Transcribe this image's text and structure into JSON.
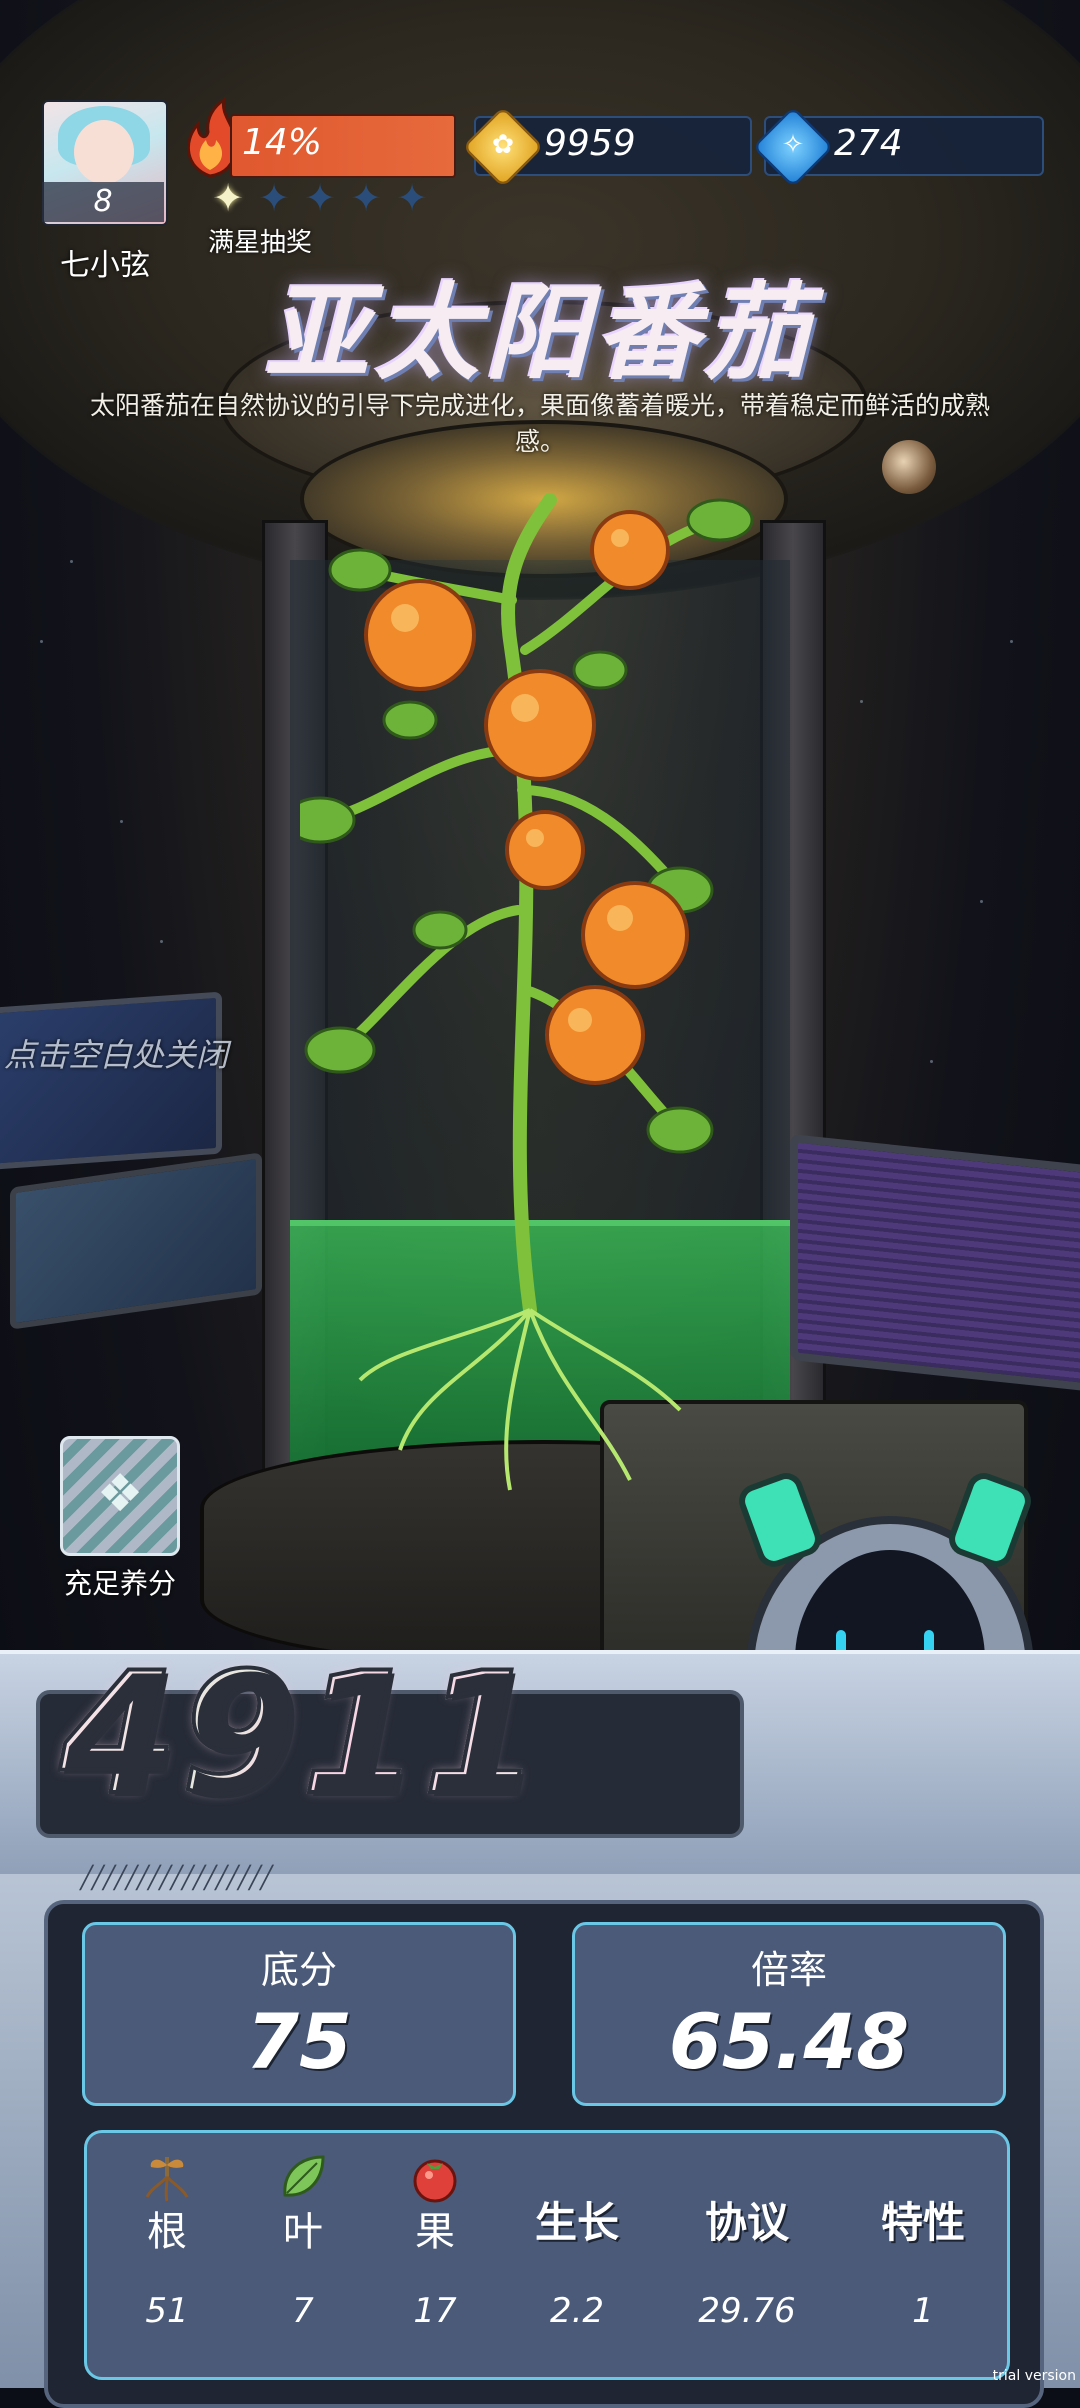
{
  "player": {
    "name": "七小弦",
    "level": "8",
    "progress_text": "14%",
    "progress_fraction": 0.14,
    "stars_total": 5,
    "stars_lit": 1,
    "lottery_label": "满星抽奖"
  },
  "resources": {
    "coins": {
      "value": "9959",
      "icon": "gold-coin-icon"
    },
    "gems": {
      "value": "274",
      "icon": "blue-gem-icon"
    }
  },
  "plant": {
    "title": "亚太阳番茄",
    "description": "太阳番茄在自然协议的引导下完成进化，果面像蓄着暖光，带着稳定而鲜活的成熟感。"
  },
  "hints": {
    "close": "点击空白处关闭",
    "nutrient_label": "充足养分"
  },
  "score": {
    "total": "4911",
    "base_label": "底分",
    "base_value": "75",
    "multiplier_label": "倍率",
    "multiplier_value": "65.48"
  },
  "stats": [
    {
      "label": "根",
      "value": "51",
      "icon": "sprout-root-icon"
    },
    {
      "label": "叶",
      "value": "7",
      "icon": "leaf-icon"
    },
    {
      "label": "果",
      "value": "17",
      "icon": "tomato-icon"
    },
    {
      "label": "生长",
      "value": "2.2",
      "icon": ""
    },
    {
      "label": "协议",
      "value": "29.76",
      "icon": ""
    },
    {
      "label": "特性",
      "value": "1",
      "icon": ""
    }
  ],
  "watermark": "trial version",
  "colors": {
    "progress": "#e0582f",
    "panel_accent": "#6ac7e6",
    "panel_fill": "#4a5a78"
  }
}
